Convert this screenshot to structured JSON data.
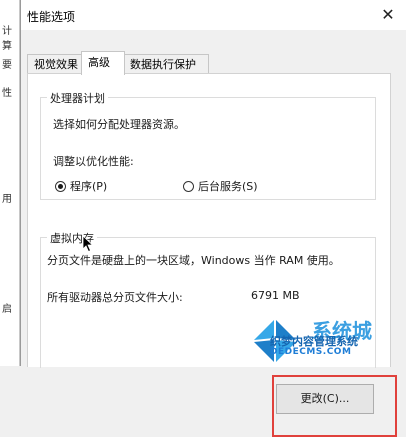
{
  "background_window": {
    "fragments": [
      "计算",
      "要",
      "性",
      "用",
      "启"
    ]
  },
  "dialog": {
    "title": "性能选项",
    "close_glyph": "✕",
    "tabs": [
      {
        "label": "视觉效果"
      },
      {
        "label": "高级"
      },
      {
        "label": "数据执行保护"
      }
    ],
    "processor": {
      "legend": "处理器计划",
      "description": "选择如何分配处理器资源。",
      "optimize_label": "调整以优化性能:",
      "options": [
        {
          "label": "程序(P)",
          "selected": true
        },
        {
          "label": "后台服务(S)",
          "selected": false
        }
      ]
    },
    "virtual_memory": {
      "legend": "虚拟内存",
      "description": "分页文件是硬盘上的一块区域，Windows 当作 RAM 使用。",
      "total_label": "所有驱动器总分页文件大小:",
      "total_value": "6791 MB",
      "change_button": "更改(C)..."
    }
  },
  "watermark": {
    "big": "系统城",
    "text": "织梦内容管理系统",
    "url": "DEDECMS.COM",
    "color": "#1a8fdc"
  },
  "accent": {
    "highlight": "#e0413c"
  }
}
